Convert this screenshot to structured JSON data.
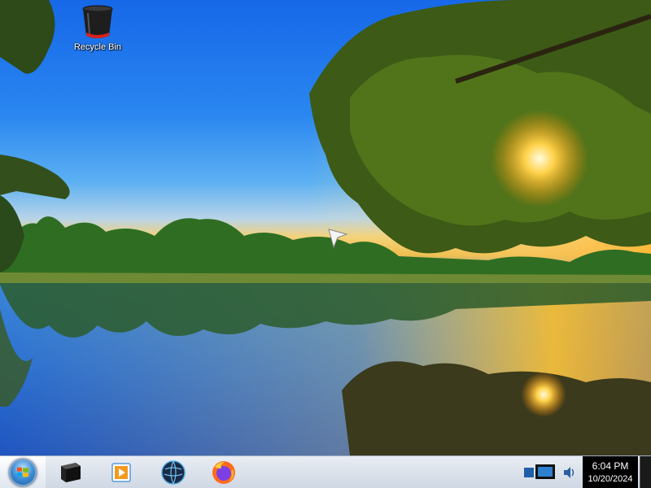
{
  "desktop": {
    "icons": [
      {
        "label": "Recycle Bin",
        "icon": "recycle-bin-icon"
      }
    ]
  },
  "taskbar": {
    "start_icon": "windows-logo-icon",
    "pinned": [
      {
        "icon": "terminal-icon"
      },
      {
        "icon": "media-player-icon"
      },
      {
        "icon": "globe-browser-icon"
      },
      {
        "icon": "firefox-icon"
      }
    ],
    "tray": [
      {
        "icon": "network-icon"
      },
      {
        "icon": "volume-icon"
      }
    ],
    "clock": {
      "time": "6:04 PM",
      "date": "10/20/2024"
    }
  }
}
